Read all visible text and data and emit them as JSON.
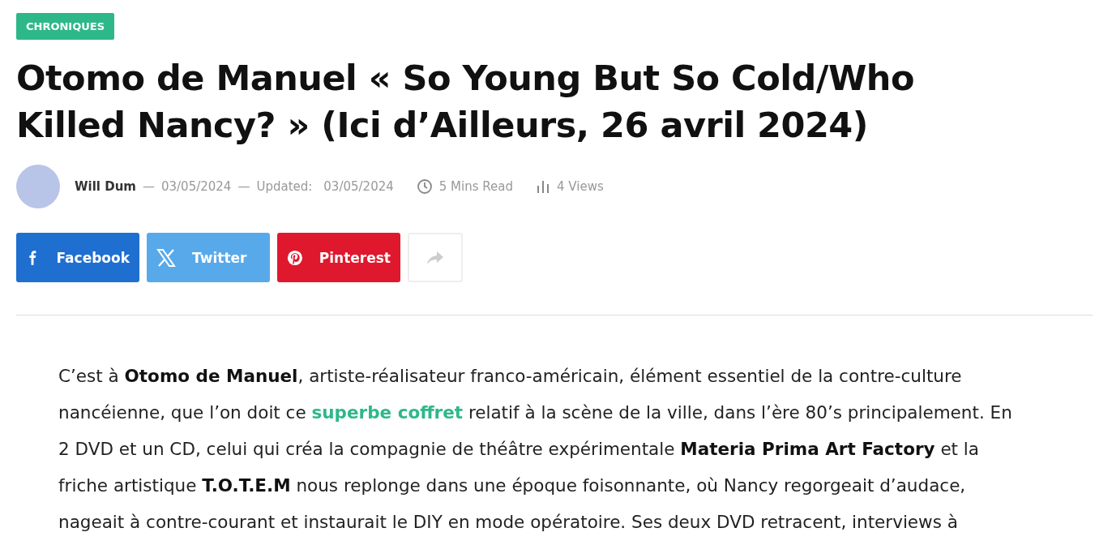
{
  "category": "CHRONIQUES",
  "title": "Otomo de Manuel « So Young But So Cold/Who Killed Nancy? » (Ici d’Ailleurs, 26 avril 2024)",
  "meta": {
    "author": "Will Dum",
    "separator_1": "—",
    "date": "03/05/2024",
    "separator_2": "—",
    "updated_label": "Updated:",
    "updated": "03/05/2024",
    "read_time": "5 Mins Read",
    "views": "4 Views"
  },
  "share": [
    {
      "kind": "facebook",
      "label": "Facebook"
    },
    {
      "kind": "twitter",
      "label": "Twitter"
    },
    {
      "kind": "pinterest",
      "label": "Pinterest"
    },
    {
      "kind": "more"
    }
  ],
  "paragraph": [
    {
      "kind": "text",
      "text": "C’est à **Otomo de Manuel**, artiste-réalisateur franco-américain, élément essentiel de la contre-culture nancéienne, que l’on doit ce "
    },
    {
      "kind": "link",
      "text": "superbe coffret"
    },
    {
      "kind": "text",
      "text": " relatif à la scène de la ville, dans l’ère 80’s principalement. En 2 DVD et un CD, celui qui créa la compagnie de théâtre expérimentale **Materia Prima Art Factory** et la friche artistique **T.O.T.E.M** nous replonge dans une époque foisonnante, où Nancy regorgeait d’audace, nageait à contre-courant et instaurait le DIY en mode opératoire. Ses deux DVD retracent, interviews à"
    }
  ]
}
